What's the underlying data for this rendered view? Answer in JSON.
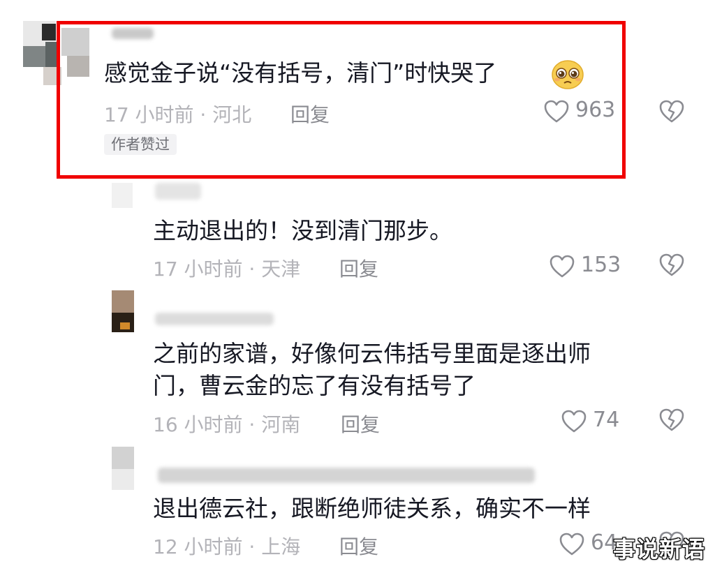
{
  "comments": [
    {
      "text": "感觉金子说“没有括号，清门”时快哭了",
      "time": "17 小时前 · 河北",
      "reply_label": "回复",
      "likes": "963",
      "badge": "作者赞过"
    },
    {
      "text": "主动退出的！没到清门那步。",
      "time": "17 小时前 · 天津",
      "reply_label": "回复",
      "likes": "153"
    },
    {
      "text_line1": "之前的家谱，好像何云伟括号里面是逐出师",
      "text_line2": "门，曹云金的忘了有没有括号了",
      "time": "16 小时前 · 河南",
      "reply_label": "回复",
      "likes": "74"
    },
    {
      "text": "退出德云社，跟断绝师徒关系，确实不一样",
      "time": "12 小时前 · 上海",
      "reply_label": "回复",
      "likes": "64"
    }
  ],
  "watermark": "事说新语",
  "colors": {
    "highlight_border": "#f00000",
    "text_primary": "#161823",
    "text_meta": "#b3b3b8",
    "badge_bg": "#f2f2f4"
  },
  "icons": [
    "heart-outline-icon",
    "broken-heart-icon",
    "pleading-face-emoji"
  ]
}
